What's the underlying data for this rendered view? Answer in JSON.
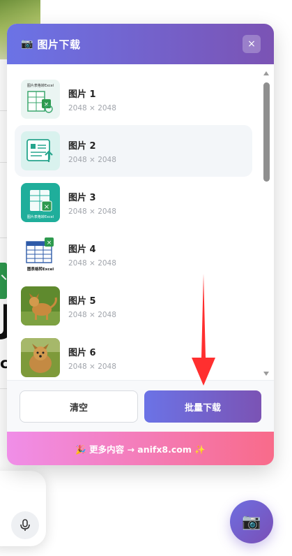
{
  "modal": {
    "title_icon": "📷",
    "title": "图片下载",
    "close_label": "×"
  },
  "items": [
    {
      "name": "图片 1",
      "size": "2048 × 2048",
      "thumb": "excel-doc-icon"
    },
    {
      "name": "图片 2",
      "size": "2048 × 2048",
      "thumb": "document-upload-icon"
    },
    {
      "name": "图片 3",
      "size": "2048 × 2048",
      "thumb": "teal-excel-icon"
    },
    {
      "name": "图片 4",
      "size": "2048 × 2048",
      "thumb": "excel-table-icon"
    },
    {
      "name": "图片 5",
      "size": "2048 × 2048",
      "thumb": "dog-photo"
    },
    {
      "name": "图片 6",
      "size": "2048 × 2048",
      "thumb": "dog-photo"
    }
  ],
  "thumb_captions": {
    "item1": "图片表格转Excel",
    "item3": "图片表格转Excel",
    "item4": "图表格转Excel"
  },
  "footer": {
    "clear_label": "清空",
    "download_label": "批量下载"
  },
  "promo": {
    "text": "🎉 更多内容 → anifx8.com ✨"
  },
  "background": {
    "letter_j": "J",
    "letter_c": "c"
  },
  "colors": {
    "accent_start": "#6b73e6",
    "accent_end": "#7b53b4",
    "promo_start": "#f08ee8",
    "promo_end": "#f86b8a"
  }
}
